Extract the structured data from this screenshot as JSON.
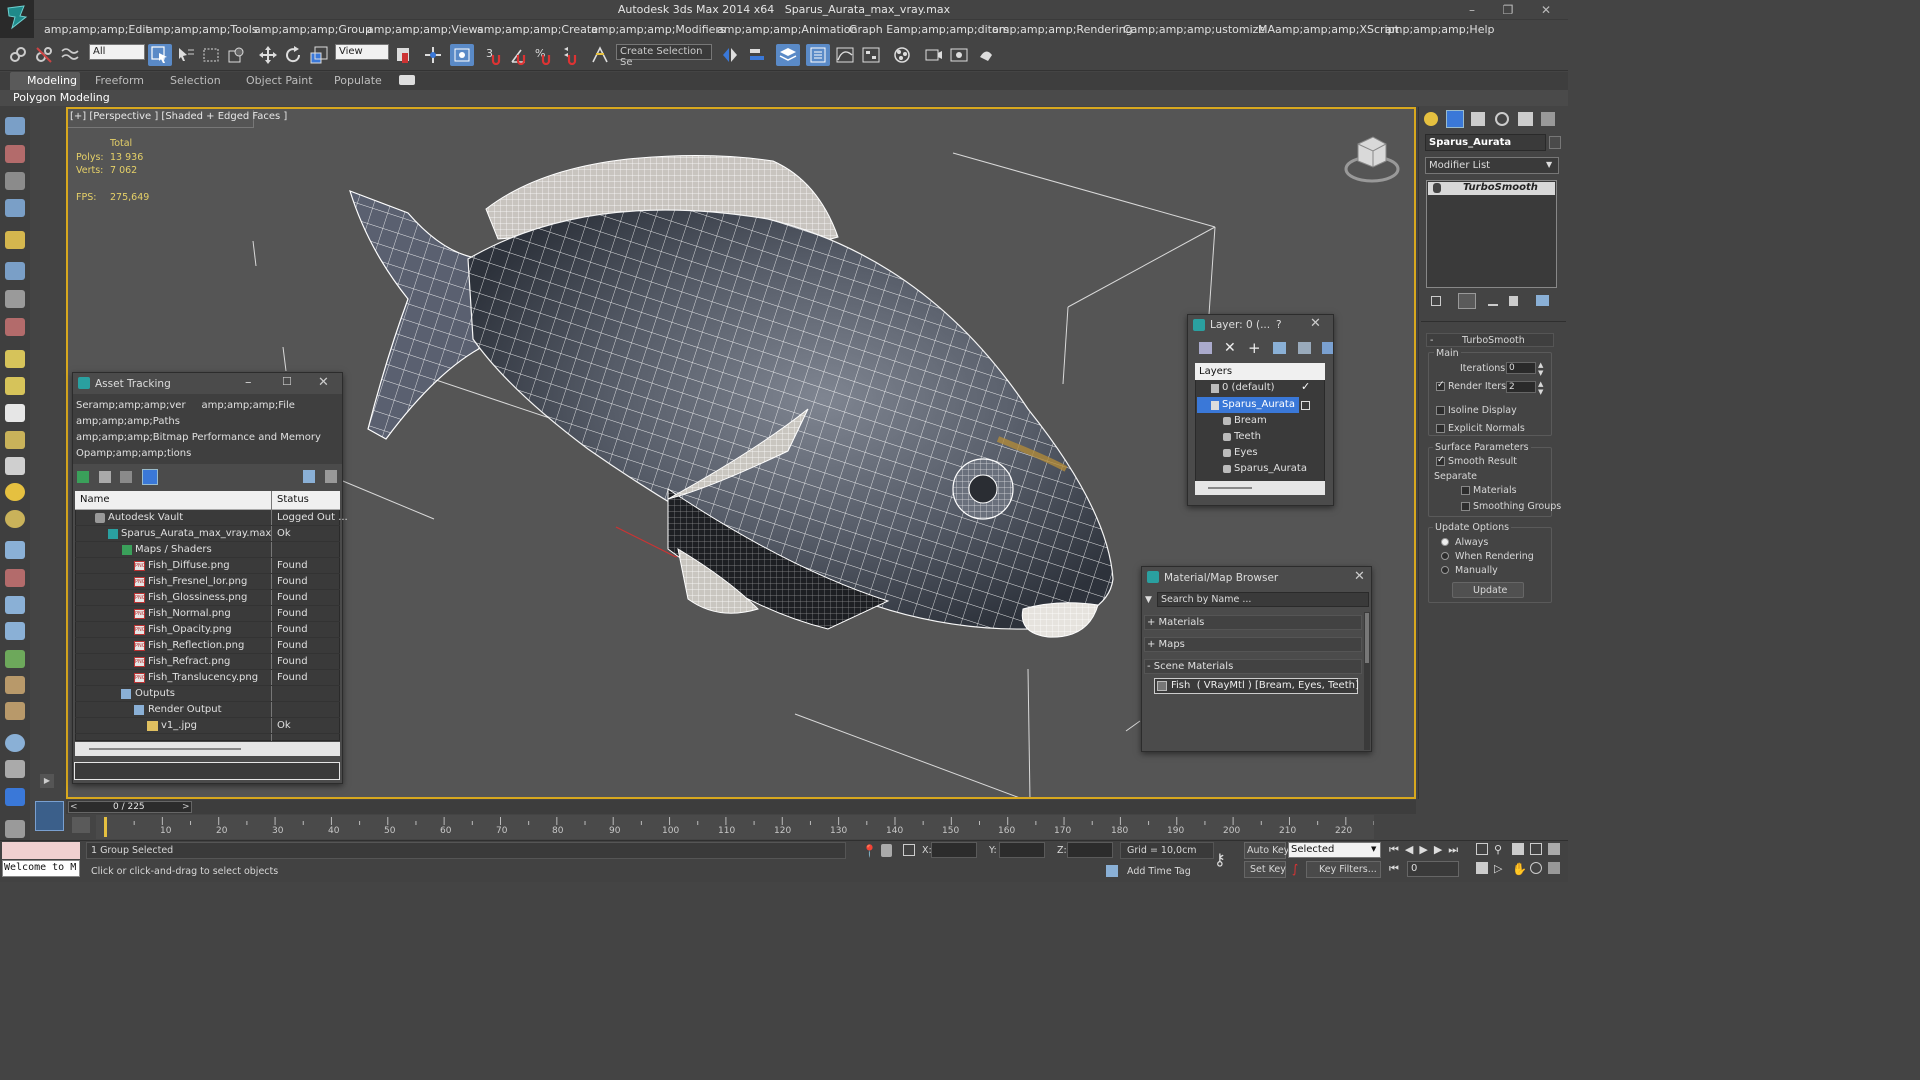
{
  "window": {
    "app_title": "Autodesk 3ds Max  2014 x64",
    "file_title": "Sparus_Aurata_max_vray.max"
  },
  "menu": [
    "amp;amp;amp;Edit",
    "amp;amp;amp;Tools",
    "amp;amp;amp;Group",
    "amp;amp;amp;Views",
    "amp;amp;amp;Create",
    "amp;amp;amp;Modifiers",
    "amp;amp;amp;Animation",
    "Graph Eamp;amp;amp;ditors",
    "amp;amp;amp;Rendering",
    "Camp;amp;amp;ustomize",
    "MAamp;amp;amp;XScript",
    "amp;amp;amp;Help"
  ],
  "toolbar": {
    "filter_value": "All",
    "ref_coord_value": "View",
    "selection_set_placeholder": "Create Selection Se"
  },
  "ribbon": {
    "tabs": [
      "Modeling",
      "Freeform",
      "Selection",
      "Object Paint",
      "Populate"
    ],
    "subpanel": "Polygon Modeling"
  },
  "viewport": {
    "label": "[+] [Perspective ] [Shaded + Edged Faces ]",
    "stats_header": "Total",
    "polys_label": "Polys:",
    "polys_value": "13 936",
    "verts_label": "Verts:",
    "verts_value": "7 062",
    "fps_label": "FPS:",
    "fps_value": "275,649"
  },
  "asset_tracking": {
    "title": "Asset Tracking",
    "menu_lines": [
      "Seramp;amp;amp;ver     amp;amp;amp;File",
      "amp;amp;amp;Paths",
      "amp;amp;amp;Bitmap Performance and Memory",
      "Opamp;amp;amp;tions"
    ],
    "col_name": "Name",
    "col_status": "Status",
    "rows": [
      {
        "name": "Autodesk Vault",
        "status": "Logged Out ..."
      },
      {
        "name": "Sparus_Aurata_max_vray.max",
        "status": "Ok"
      },
      {
        "name": "Maps / Shaders",
        "status": ""
      },
      {
        "name": "Fish_Diffuse.png",
        "status": "Found"
      },
      {
        "name": "Fish_Fresnel_Ior.png",
        "status": "Found"
      },
      {
        "name": "Fish_Glossiness.png",
        "status": "Found"
      },
      {
        "name": "Fish_Normal.png",
        "status": "Found"
      },
      {
        "name": "Fish_Opacity.png",
        "status": "Found"
      },
      {
        "name": "Fish_Reflection.png",
        "status": "Found"
      },
      {
        "name": "Fish_Refract.png",
        "status": "Found"
      },
      {
        "name": "Fish_Translucency.png",
        "status": "Found"
      },
      {
        "name": "Outputs",
        "status": ""
      },
      {
        "name": "Render Output",
        "status": ""
      },
      {
        "name": "v1_.jpg",
        "status": "Ok"
      }
    ]
  },
  "layer_dialog": {
    "title": "Layer: 0 (...",
    "help": "?",
    "header": "Layers",
    "items": [
      "0 (default)",
      "Sparus_Aurata",
      "Bream",
      "Teeth",
      "Eyes",
      "Sparus_Aurata"
    ]
  },
  "material_browser": {
    "title": "Material/Map Browser",
    "search_placeholder": "Search by Name ...",
    "sections": [
      "+ Materials",
      "+ Maps",
      "- Scene Materials"
    ],
    "scene_material": "Fish  ( VRayMtl ) [Bream, Eyes, Teeth]"
  },
  "command_panel": {
    "object_name": "Sparus_Aurata",
    "modifier_list": "Modifier List",
    "stack_item": "TurboSmooth",
    "rollout_title": "TurboSmooth",
    "main_group": "Main",
    "iterations_label": "Iterations:",
    "iterations_value": "0",
    "render_iters_label": "Render Iters:",
    "render_iters_value": "2",
    "render_iters_checked": true,
    "isoline_label": "Isoline Display",
    "isoline_checked": false,
    "explicit_label": "Explicit Normals",
    "explicit_checked": false,
    "surface_group": "Surface Parameters",
    "smooth_result_label": "Smooth Result",
    "smooth_result_checked": true,
    "separate_label": "Separate",
    "materials_label": "Materials",
    "smoothing_groups_label": "Smoothing Groups",
    "update_group": "Update Options",
    "always_label": "Always",
    "when_rendering_label": "When Rendering",
    "manually_label": "Manually",
    "update_button": "Update"
  },
  "timeline": {
    "slider_text": "0 / 225",
    "prev": "<",
    "next": ">",
    "ticks": [
      "10",
      "20",
      "30",
      "40",
      "50",
      "60",
      "70",
      "80",
      "90",
      "100",
      "110",
      "120",
      "130",
      "140",
      "150",
      "160",
      "170",
      "180",
      "190",
      "200",
      "210",
      "220"
    ]
  },
  "statusbar": {
    "listener": "Welcome to M",
    "selection": "1 Group Selected",
    "prompt": "Click or click-and-drag to select objects",
    "x_label": "X:",
    "y_label": "Y:",
    "z_label": "Z:",
    "grid": "Grid = 10,0cm",
    "add_time_tag": "Add Time Tag",
    "auto_key": "Auto Key",
    "set_key": "Set Key",
    "selected_value": "Selected",
    "key_filters": "Key Filters...",
    "frame_value": "0"
  },
  "colors": {
    "viewport_border": "#d8a81e",
    "selection_blue": "#3a78d8",
    "stats_yellow": "#e5d068"
  }
}
